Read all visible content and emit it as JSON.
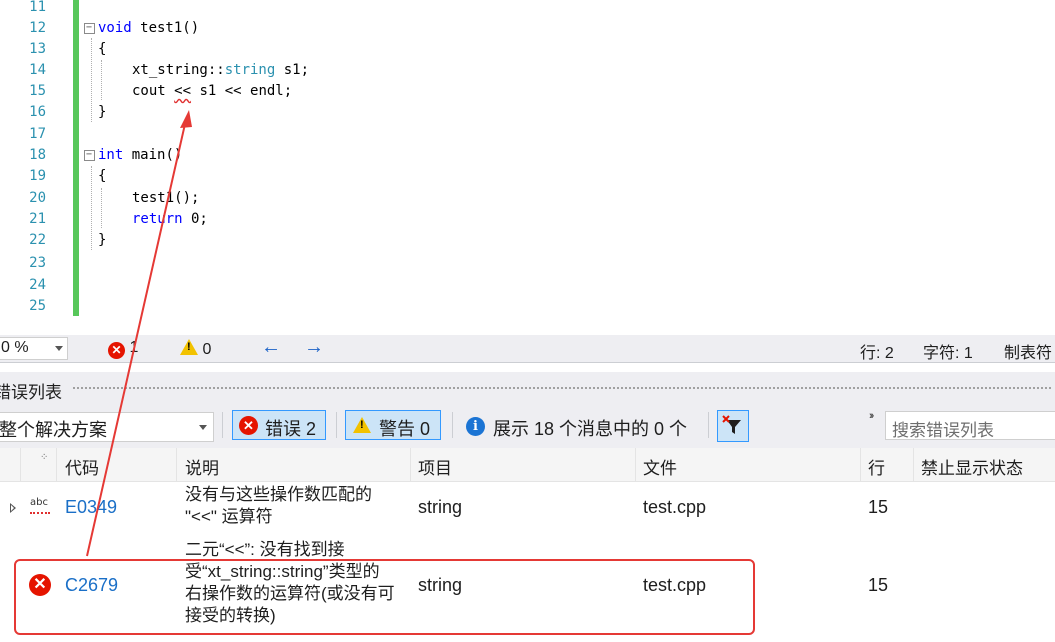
{
  "editor": {
    "lines": [
      {
        "num": "11",
        "code": ""
      },
      {
        "num": "12",
        "code": "void test1()"
      },
      {
        "num": "13",
        "code": "{"
      },
      {
        "num": "14",
        "code": "xt_string::string s1;"
      },
      {
        "num": "15",
        "code": "cout << s1 << endl;"
      },
      {
        "num": "16",
        "code": "}"
      },
      {
        "num": "17",
        "code": ""
      },
      {
        "num": "18",
        "code": "int main()"
      },
      {
        "num": "19",
        "code": "{"
      },
      {
        "num": "20",
        "code": "test1();"
      },
      {
        "num": "21",
        "code": "return 0;"
      },
      {
        "num": "22",
        "code": "}"
      },
      {
        "num": "23",
        "code": ""
      },
      {
        "num": "24",
        "code": ""
      },
      {
        "num": "25",
        "code": ""
      }
    ]
  },
  "statusbar": {
    "zoom": "0 %",
    "errors": "1",
    "warnings": "0",
    "line": "行: 2",
    "char": "字符: 1",
    "tabs": "制表符"
  },
  "panel": {
    "title": "错误列表",
    "scope": "整个解决方案",
    "errors_button": "错误 2",
    "warnings_button": "警告 0",
    "messages_label": "展示 18 个消息中的 0 个",
    "search_placeholder": "搜索错误列表"
  },
  "table": {
    "headers": [
      "代码",
      "说明",
      "项目",
      "文件",
      "行",
      "禁止显示状态"
    ],
    "rows": [
      {
        "code": "E0349",
        "description": [
          "没有与这些操作数匹配的",
          "\"<<\" 运算符"
        ],
        "project": "string",
        "file": "test.cpp",
        "line": "15"
      },
      {
        "code": "C2679",
        "description": [
          "二元“<<”: 没有找到接",
          "受“xt_string::string”类型的",
          "右操作数的运算符(或没有可",
          "接受的转换)"
        ],
        "project": "string",
        "file": "test.cpp",
        "line": "15"
      }
    ]
  },
  "colors": {
    "accent": "#1b62c7",
    "error": "#e51400",
    "warning": "#f2c200",
    "annotation": "#e53935",
    "changed_lines": "#57c75a"
  }
}
